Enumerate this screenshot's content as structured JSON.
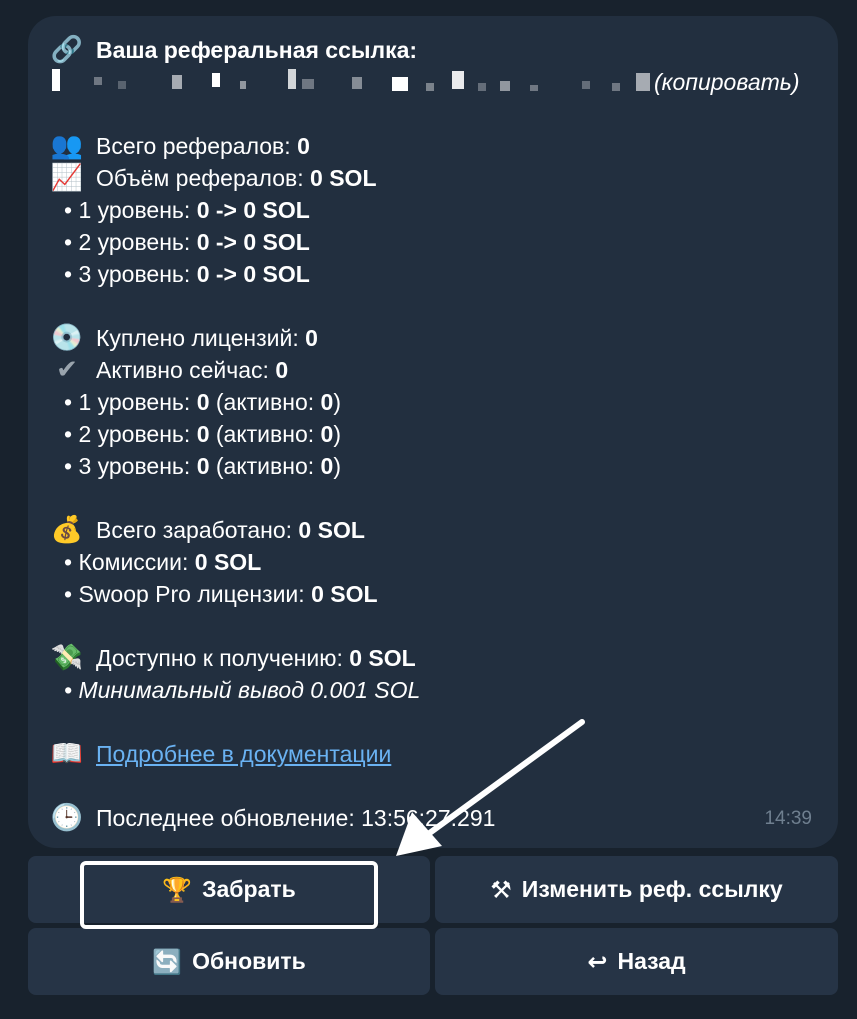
{
  "message": {
    "ref_link": {
      "icon": "link-icon",
      "title": "Ваша реферальная ссылка:",
      "copy_label": "(копировать)"
    },
    "referrals_total": {
      "icon": "people-icon",
      "label": "Всего рефералов:",
      "value": "0"
    },
    "referrals_volume": {
      "icon": "chart-up-icon",
      "label": "Объём рефералов:",
      "value": "0 SOL"
    },
    "volume_levels": [
      {
        "label": "1 уровень:",
        "value": "0 -> 0 SOL"
      },
      {
        "label": "2 уровень:",
        "value": "0 -> 0 SOL"
      },
      {
        "label": "3 уровень:",
        "value": "0 -> 0 SOL"
      }
    ],
    "licenses_bought": {
      "icon": "disc-icon",
      "label": "Куплено лицензий:",
      "value": "0"
    },
    "active_now": {
      "icon": "checkmark-icon",
      "label": "Активно сейчас:",
      "value": "0"
    },
    "license_levels": [
      {
        "label": "1 уровень:",
        "value": "0",
        "active_label": "(активно:",
        "active_value": "0",
        "close": ")"
      },
      {
        "label": "2 уровень:",
        "value": "0",
        "active_label": "(активно:",
        "active_value": "0",
        "close": ")"
      },
      {
        "label": "3 уровень:",
        "value": "0",
        "active_label": "(активно:",
        "active_value": "0",
        "close": ")"
      }
    ],
    "earned_total": {
      "icon": "money-bag-icon",
      "label": "Всего заработано:",
      "value": "0 SOL"
    },
    "earned_items": [
      {
        "label": "Комиссии:",
        "value": "0 SOL"
      },
      {
        "label": "Swoop Pro лицензии:",
        "value": "0 SOL"
      }
    ],
    "available": {
      "icon": "flying-money-icon",
      "label": "Доступно к получению:",
      "value": "0 SOL"
    },
    "min_withdraw": "Минимальный вывод 0.001 SOL",
    "docs": {
      "icon": "book-icon",
      "label": "Подробнее в документации"
    },
    "last_update": {
      "icon": "clock-icon",
      "label": "Последнее обновление:",
      "value": "13:56:27.291"
    },
    "time": "14:39"
  },
  "keyboard": {
    "claim": {
      "icon": "trophy-icon",
      "label": "Забрать"
    },
    "change_link": {
      "icon": "tools-icon",
      "label": "Изменить реф. ссылку"
    },
    "refresh": {
      "icon": "refresh-icon",
      "label": "Обновить"
    },
    "back": {
      "icon": "back-icon",
      "label": "Назад"
    }
  }
}
